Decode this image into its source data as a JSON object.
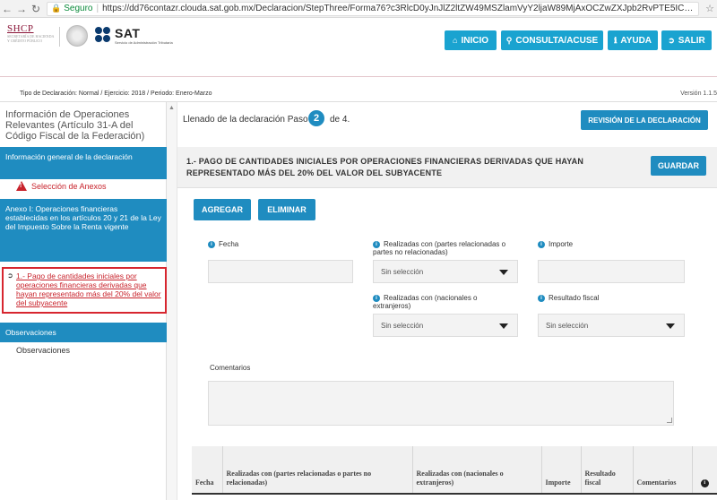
{
  "browser": {
    "secure_label": "Seguro",
    "url": "https://dd76contazr.clouda.sat.gob.mx/Declaracion/StepThree/Forma76?c3RlcD0yJnJlZ2ltZW49MSZlamVyY2ljaW89MjAxOCZwZXJpb2RvPTE5ICZwZXJpb2RvZGVzYz1F..."
  },
  "header": {
    "shcp_logo": "SHCP",
    "shcp_sub": "SECRETARÍA DE HACIENDA Y CRÉDITO PÚBLICO",
    "sat_logo": "SAT",
    "sat_sub": "Servicio de Administración Tributaria",
    "nav": [
      {
        "label": "INICIO",
        "icon": "home-icon"
      },
      {
        "label": "CONSULTA/ACUSE",
        "icon": "search-icon"
      },
      {
        "label": "AYUDA",
        "icon": "info-icon"
      },
      {
        "label": "SALIR",
        "icon": "exit-icon"
      }
    ]
  },
  "infobar": {
    "declaration_info": "Tipo de Declaración: Normal / Ejercicio: 2018 / Periodo: Enero-Marzo",
    "version": "Versión 1.1.5"
  },
  "sidebar": {
    "title": "Información de Operaciones Relevantes (Artículo 31-A del Código Fiscal de la Federación)",
    "general_section": "Información general de la declaración",
    "anexos_link": "Selección de Anexos",
    "anexo1_section": "Anexo I: Operaciones financieras establecidas en los artículos 20 y 21 de la Ley del Impuesto Sobre la Renta vigente",
    "anexo1_item": "1.- Pago de cantidades iniciales por operaciones financieras derivadas que hayan representado más del 20% del valor del subyacente",
    "observaciones_section": "Observaciones",
    "observaciones_item": "Observaciones"
  },
  "main": {
    "step_label": "Llenado de la declaración Paso",
    "step_number": "2",
    "step_of": "de 4.",
    "review_button": "REVISIÓN DE LA DECLARACIÓN",
    "section_title": "1.- PAGO DE CANTIDADES INICIALES POR OPERACIONES FINANCIERAS DERIVADAS QUE HAYAN REPRESENTADO MÁS DEL 20% DEL VALOR DEL SUBYACENTE",
    "save_button": "GUARDAR",
    "add_button": "AGREGAR",
    "delete_button": "ELIMINAR",
    "fields": {
      "fecha_label": "Fecha",
      "fecha_value": "",
      "realizadas_partes_label": "Realizadas con (partes relacionadas o partes no relacionadas)",
      "realizadas_partes_value": "Sin selección",
      "importe_label": "Importe",
      "importe_value": "",
      "realizadas_nac_label": "Realizadas con (nacionales o extranjeros)",
      "realizadas_nac_value": "Sin selección",
      "resultado_label": "Resultado fiscal",
      "resultado_value": "Sin selección",
      "comentarios_label": "Comentarios",
      "comentarios_value": ""
    },
    "table": {
      "headers": [
        "Fecha",
        "Realizadas con (partes relacionadas o partes no relacionadas)",
        "Realizadas con (nacionales o extranjeros)",
        "Importe",
        "Resultado fiscal",
        "Comentarios"
      ]
    }
  }
}
